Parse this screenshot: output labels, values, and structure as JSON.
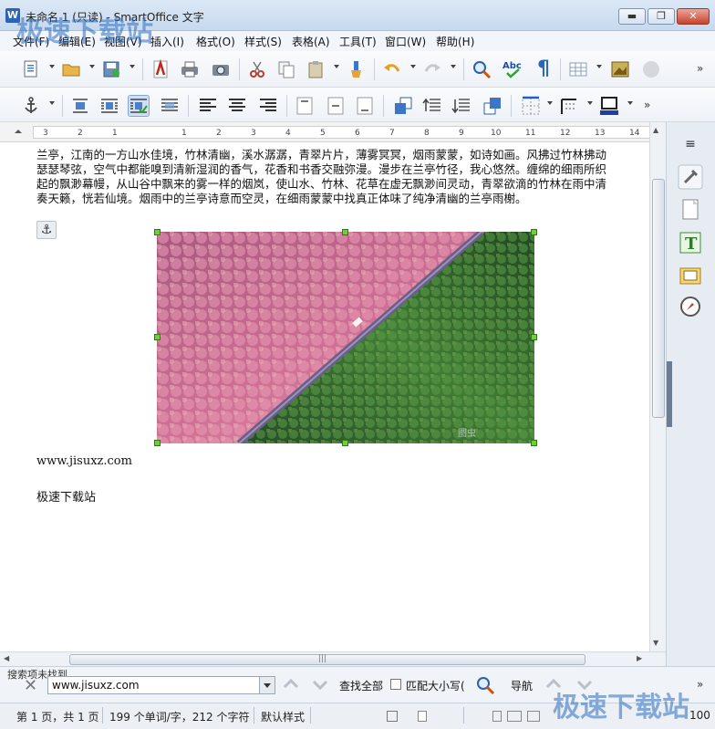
{
  "window": {
    "title": "未命名 1 (只读) - SmartOffice 文字",
    "app_icon_letter": "W",
    "min_glyph": "▬",
    "max_glyph": "❐",
    "close_glyph": "✕"
  },
  "watermark": {
    "text": "极速下载站",
    "color": "#2d6fc2"
  },
  "menu": [
    "文件(F)",
    "编辑(E)",
    "视图(V)",
    "插入(I)",
    "格式(O)",
    "样式(S)",
    "表格(A)",
    "工具(T)",
    "窗口(W)",
    "帮助(H)"
  ],
  "toolbar1": {
    "icons": [
      "new-document-icon",
      "open-folder-icon",
      "save-icon",
      "export-pdf-icon",
      "print-icon",
      "print-preview-icon",
      "cut-icon",
      "copy-icon",
      "paste-icon",
      "format-paintbrush-icon",
      "undo-icon",
      "redo-icon",
      "find-replace-icon",
      "spellcheck-icon",
      "formatting-marks-icon",
      "table-icon",
      "image-icon",
      "chart-icon"
    ],
    "spellcheck_text": "Abc",
    "pilcrow": "¶",
    "more": "»"
  },
  "toolbar2": {
    "icons": [
      "anchor-icon",
      "wrap-off-icon",
      "page-wrap-icon",
      "optimal-wrap-icon",
      "wrap-through-icon",
      "align-left-icon",
      "align-center-icon",
      "align-right-icon",
      "align-top-icon",
      "align-middle-icon",
      "align-bottom-icon",
      "bring-to-front-icon",
      "bring-forward-icon",
      "send-backward-icon",
      "send-to-back-icon",
      "borders-icon",
      "line-style-icon",
      "line-color-icon"
    ],
    "more": "»"
  },
  "ruler": {
    "labels": [
      "3",
      "2",
      "1",
      "1",
      "2",
      "3",
      "4",
      "5",
      "6",
      "7",
      "8",
      "9",
      "10",
      "11",
      "12",
      "13",
      "14"
    ]
  },
  "document": {
    "paragraph": "兰亭，江南的一方山水佳境，竹林清幽，溪水潺潺，青翠片片，薄雾冥冥，烟雨蒙蒙，如诗如画。风拂过竹林拂动瑟瑟琴弦，空气中都能嗅到清新湿润的香气，花香和书香交融弥漫。漫步在兰亭竹径，我心悠然。缠绵的细雨所织起的飘渺幕幔，从山谷中飘来的雾一样的烟岚，使山水、竹林、花草在虚无飘渺间灵动，青翠欲滴的竹林在雨中清奏天籁，恍若仙境。烟雨中的兰亭诗意而空灵，在细雨蒙蒙中找真正体味了纯净清幽的兰亭雨榭。",
    "anchor_glyph": "⚓",
    "image_icon": "aerial-forest-road-image",
    "image_caption": "图虫",
    "line1": "www.jisuxz.com",
    "line2": "极速下载站"
  },
  "scroll": {
    "up": "▲",
    "down": "▼",
    "left": "◀",
    "right": "▶",
    "grip": "|||"
  },
  "sidebar": {
    "icons": [
      "sidebar-menu-icon",
      "properties-icon",
      "page-icon",
      "styles-icon",
      "gallery-icon",
      "navigator-icon"
    ],
    "menu_glyph": "≡",
    "styles_glyph": "T"
  },
  "find": {
    "status": "搜索项未找到",
    "close_glyph": "✕",
    "value": "www.jisuxz.com",
    "find_all": "查找全部",
    "match_case": "匹配大小写(",
    "navigation": "导航",
    "more": "»"
  },
  "status": {
    "page": "第 1 页，共 1 页",
    "words": "199 个单词/字，212 个字符",
    "style": "默认样式",
    "zoom": "100"
  },
  "colors": {
    "accent": "#2a63b8",
    "selection_handle": "#6fcf3a",
    "forest_pink": "#c8618f",
    "forest_green": "#2e6b2c"
  }
}
